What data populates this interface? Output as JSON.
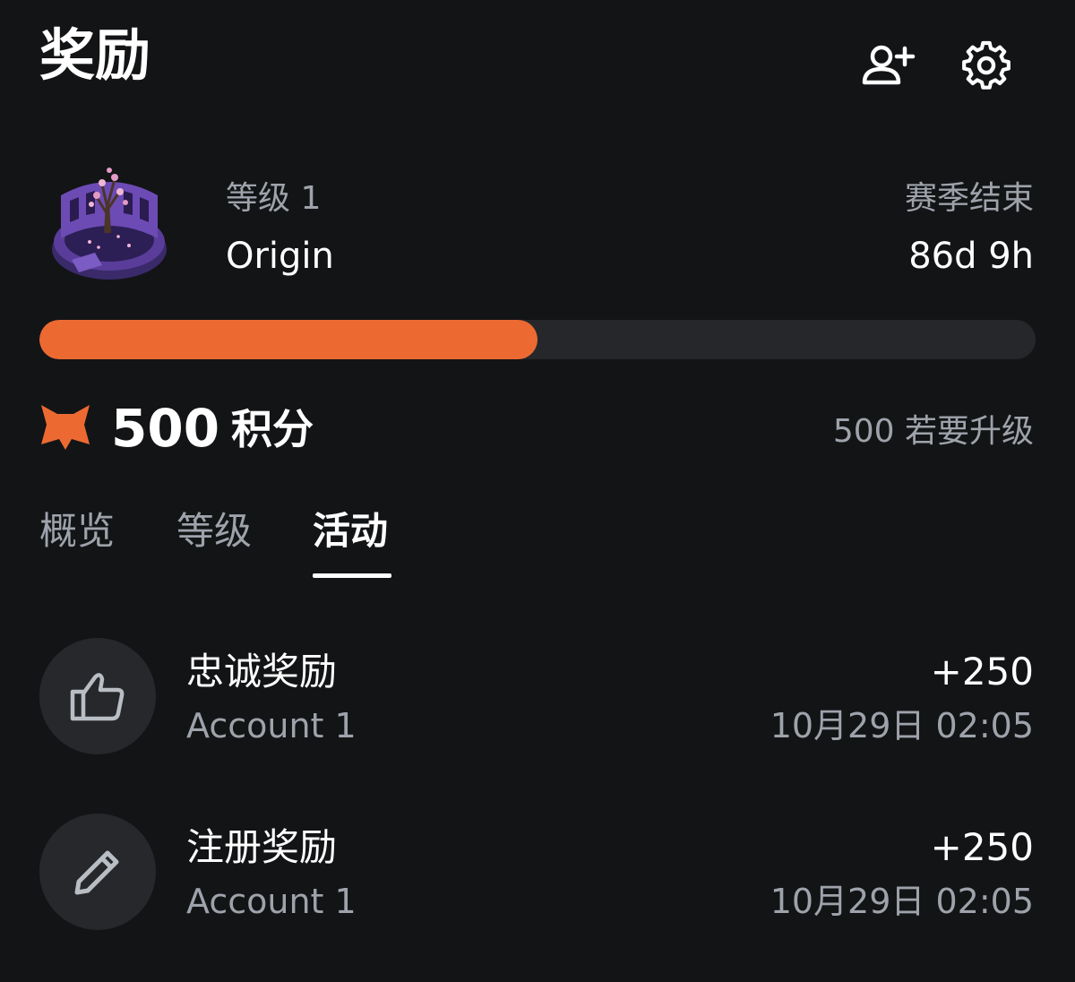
{
  "header": {
    "title": "奖励",
    "add_user_icon": "person-add-icon",
    "settings_icon": "gear-icon"
  },
  "level": {
    "label": "等级 1",
    "name": "Origin",
    "art_icon": "origin-level-artwork",
    "season_label": "赛季结束",
    "season_remaining": "86d 9h"
  },
  "progress": {
    "fraction": 0.5,
    "fill_color": "#ec6a32",
    "track_color": "#26272b"
  },
  "points": {
    "value": "500",
    "unit": "积分",
    "icon": "fox-points-icon",
    "upgrade_note": "500 若要升级"
  },
  "tabs": [
    {
      "label": "概览",
      "active": false
    },
    {
      "label": "等级",
      "active": false
    },
    {
      "label": "活动",
      "active": true
    }
  ],
  "activities": [
    {
      "title": "忠诚奖励",
      "account": "Account 1",
      "points": "+250",
      "time": "10月29日 02:05",
      "icon": "thumbs-up-icon"
    },
    {
      "title": "注册奖励",
      "account": "Account 1",
      "points": "+250",
      "time": "10月29日 02:05",
      "icon": "pencil-icon"
    }
  ],
  "colors": {
    "background": "#131416",
    "accent": "#ec6a32",
    "muted_text": "#9ea3ab"
  }
}
